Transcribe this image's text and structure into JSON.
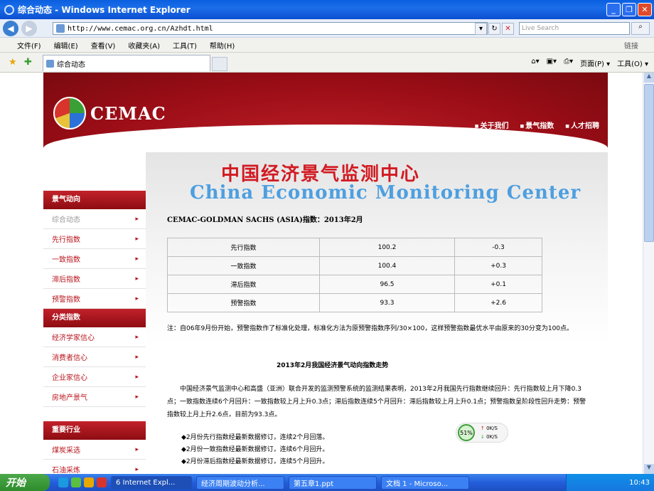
{
  "window": {
    "title": "综合动态 - Windows Internet Explorer"
  },
  "address": {
    "url": "http://www.cemac.org.cn/Azhdt.html",
    "search_placeholder": "Live Search"
  },
  "menu": [
    "文件(F)",
    "编辑(E)",
    "查看(V)",
    "收藏夹(A)",
    "工具(T)",
    "帮助(H)"
  ],
  "menu_links_label": "链接",
  "tab": {
    "label": "综合动态"
  },
  "toolbar": {
    "page_label": "页面(P) ▾",
    "tools_label": "工具(O) ▾"
  },
  "site": {
    "logo_text": "CEMAC",
    "top_nav": [
      "关于我们",
      "景气指数",
      "人才招聘"
    ],
    "title_cn": "中国经济景气监测中心",
    "title_en": "China Economic Monitoring Center"
  },
  "sidebar": {
    "sections": [
      {
        "title": "景气动向",
        "items": [
          "综合动态",
          "先行指数",
          "一致指数",
          "滞后指数",
          "预警指数"
        ]
      },
      {
        "title": "分类指数",
        "items": [
          "经济学家信心",
          "消费者信心",
          "企业家信心",
          "房地产景气"
        ]
      },
      {
        "title": "重要行业",
        "items": [
          "煤炭采选",
          "石油采炼"
        ]
      }
    ]
  },
  "content": {
    "index_title": "CEMAC-GOLDMAN SACHS (ASIA)指数：2013年2月",
    "table": [
      {
        "name": "先行指数",
        "value": "100.2",
        "change": "-0.3"
      },
      {
        "name": "一致指数",
        "value": "100.4",
        "change": "+0.3"
      },
      {
        "name": "滞后指数",
        "value": "96.5",
        "change": "+0.1"
      },
      {
        "name": "预警指数",
        "value": "93.3",
        "change": "+2.6"
      }
    ],
    "note": "注：自06年9月份开始，预警指数作了标准化处理，标准化方法为原预警指数序列/30×100，这样预警指数最优水平由原来的30分变为100点。",
    "subtitle": "2013年2月我国经济景气动向指数走势",
    "paragraph": "中国经济景气监测中心和高盛（亚洲）联合开发的监测预警系统的监测结果表明，2013年2月我国先行指数继续回升：先行指数较上月下降0.3点；一致指数连续6个月回升：一致指数较上月上升0.3点；滞后指数连续5个月回升：滞后指数较上月上升0.1点；预警指数呈阶段性回升走势：预警指数较上月上升2.6点，目前为93.3点。",
    "bullets": [
      "◆2月份先行指数经最新数据修订，连续2个月回落。",
      "◆2月份一致指数经最新数据修订，连续6个月回升。",
      "◆2月份滞后指数经最新数据修订，连续5个月回升。"
    ]
  },
  "speed_widget": {
    "percent": "51%",
    "up": "0K/S",
    "down": "0K/S"
  },
  "taskbar": {
    "start": "开始",
    "items": [
      "6 Internet Expl...",
      "经济周期波动分析...",
      "第五章1.ppt",
      "文档 1 - Microso..."
    ],
    "clock": "10:43"
  }
}
